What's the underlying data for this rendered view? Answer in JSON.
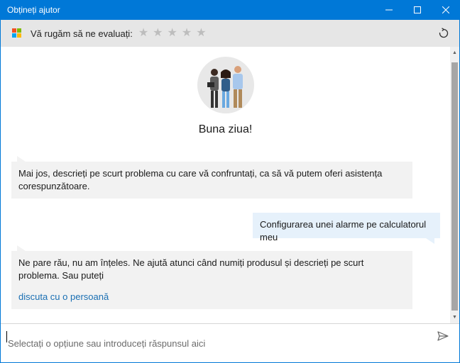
{
  "window": {
    "title": "Obțineți ajutor"
  },
  "rating": {
    "label": "Vă rugăm să ne evaluați:",
    "stars": 5,
    "selected": 0
  },
  "chat": {
    "greeting": "Buna ziua!",
    "messages": [
      {
        "from": "bot",
        "text": "Mai jos, descrieți pe scurt problema cu care vă confruntați, ca să vă putem oferi asistența corespunzătoare."
      },
      {
        "from": "user",
        "text": "Configurarea unei alarme pe calculatorul meu"
      },
      {
        "from": "bot",
        "text": "Ne pare rău, nu am înțeles. Ne ajută atunci când numiți produsul și descrieți pe scurt problema. Sau puteți",
        "link": "discuta cu o persoană"
      }
    ]
  },
  "input": {
    "placeholder": "Selectați o opțiune sau introduceți răspunsul aici",
    "value": ""
  },
  "colors": {
    "titlebar": "#0078d7",
    "link": "#1a6fb3",
    "user_bubble": "#e6f1fb",
    "bot_bubble": "#f2f2f2"
  },
  "icons": [
    "microsoft-logo-icon",
    "star-icon",
    "refresh-icon",
    "send-icon",
    "minimize-icon",
    "maximize-icon",
    "close-icon"
  ]
}
